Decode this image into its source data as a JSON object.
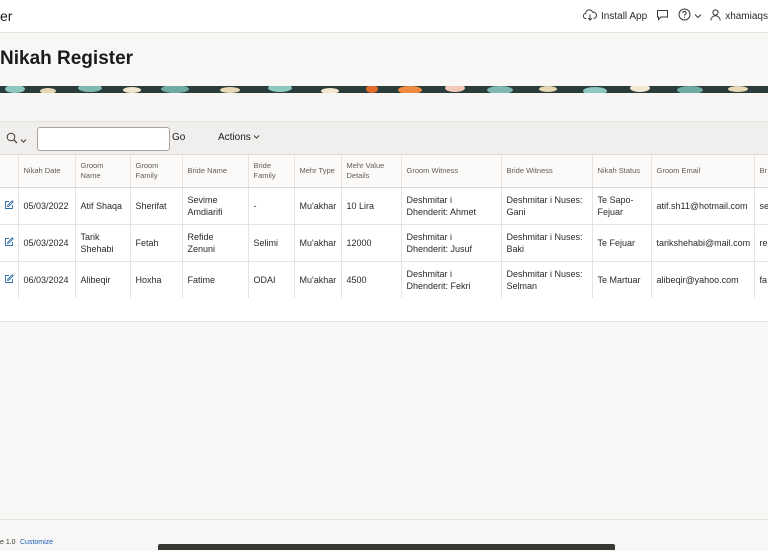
{
  "header": {
    "app_title_fragment": "er",
    "install_app_label": "Install App",
    "username": "xhamiaqs"
  },
  "page": {
    "title": "Nikah Register"
  },
  "toolbar": {
    "go_label": "Go",
    "actions_label": "Actions",
    "search_value": ""
  },
  "grid": {
    "columns": [
      "Nikah Date",
      "Groom Name",
      "Groom Family",
      "Bride Name",
      "Bride Family",
      "Mehr Type",
      "Mehr Value Details",
      "Groom Witness",
      "Bride Witness",
      "Nikah Status",
      "Groom Email",
      "Br"
    ],
    "rows": [
      [
        "05/03/2022",
        "Atif Shaqa",
        "Sherifat",
        "Sevime Amdiarifi",
        "-",
        "Mu'akhar",
        "10 Lira",
        "Deshmitar i Dhenderit: Ahmet",
        "Deshmitar i Nuses: Gani",
        "Te Sapo-Fejuar",
        "atif.sh11@hotmail.com",
        "se"
      ],
      [
        "05/03/2024",
        "Tarik Shehabi",
        "Fetah",
        "Refide Zenuni",
        "Selimi",
        "Mu'akhar",
        "12000",
        "Deshmitar i Dhenderit: Jusuf",
        "Deshmitar i Nuses: Baki",
        "Te Fejuar",
        "tarikshehabi@mail.com",
        "re"
      ],
      [
        "06/03/2024",
        "Alibeqir",
        "Hoxha",
        "Fatime",
        "ODAI",
        "Mu'akhar",
        "4500",
        "Deshmitar i Dhenderit: Fekri",
        "Deshmitar i Nuses: Selman",
        "Te Martuar",
        "alibeqir@yahoo.com",
        "fa"
      ]
    ]
  },
  "footer": {
    "version_fragment": "e 1.0",
    "customize_label": "Customize"
  },
  "colors": {
    "accent_link": "#1a5fb4",
    "edit_icon": "#2f6ea3",
    "banner_base": "#2a3d3a"
  }
}
